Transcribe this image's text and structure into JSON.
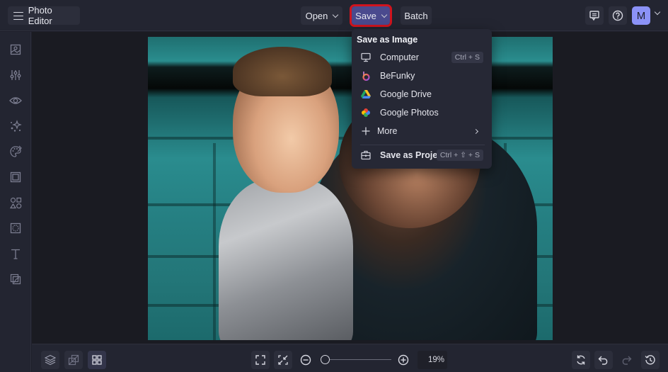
{
  "app": {
    "title": "Photo Editor",
    "accent_color": "#4a4a8e",
    "highlight_color": "#d0141e"
  },
  "topbar": {
    "menu_icon": "hamburger-icon",
    "open_label": "Open",
    "save_label": "Save",
    "batch_label": "Batch",
    "feedback_icon": "comment-icon",
    "help_icon": "help-circle-icon",
    "avatar_initial": "M",
    "avatar_color": "#8b92f7"
  },
  "sidebar": {
    "items": [
      {
        "icon": "image-icon",
        "label": "Edit"
      },
      {
        "icon": "sliders-icon",
        "label": "Adjust"
      },
      {
        "icon": "eye-icon",
        "label": "Touch Up"
      },
      {
        "icon": "sparkle-icon",
        "label": "Effects"
      },
      {
        "icon": "palette-icon",
        "label": "Artsy"
      },
      {
        "icon": "frame-icon",
        "label": "Frames"
      },
      {
        "icon": "shapes-icon",
        "label": "Graphics"
      },
      {
        "icon": "overlay-icon",
        "label": "Overlays"
      },
      {
        "icon": "text-icon",
        "label": "Text"
      },
      {
        "icon": "textures-icon",
        "label": "Textures"
      }
    ]
  },
  "save_menu": {
    "heading": "Save as Image",
    "items": [
      {
        "label": "Computer",
        "icon": "monitor-icon",
        "shortcut": "Ctrl + S"
      },
      {
        "label": "BeFunky",
        "icon": "befunky-icon",
        "shortcut": ""
      },
      {
        "label": "Google Drive",
        "icon": "google-drive-icon",
        "shortcut": ""
      },
      {
        "label": "Google Photos",
        "icon": "google-photos-icon",
        "shortcut": ""
      },
      {
        "label": "More",
        "icon": "plus-icon",
        "shortcut": ""
      }
    ],
    "project": {
      "label": "Save as Project",
      "icon": "briefcase-icon",
      "shortcut": "Ctrl + ⇧ + S"
    }
  },
  "bottombar": {
    "zoom_percent": "19%",
    "zoom_fraction": 0.02
  }
}
